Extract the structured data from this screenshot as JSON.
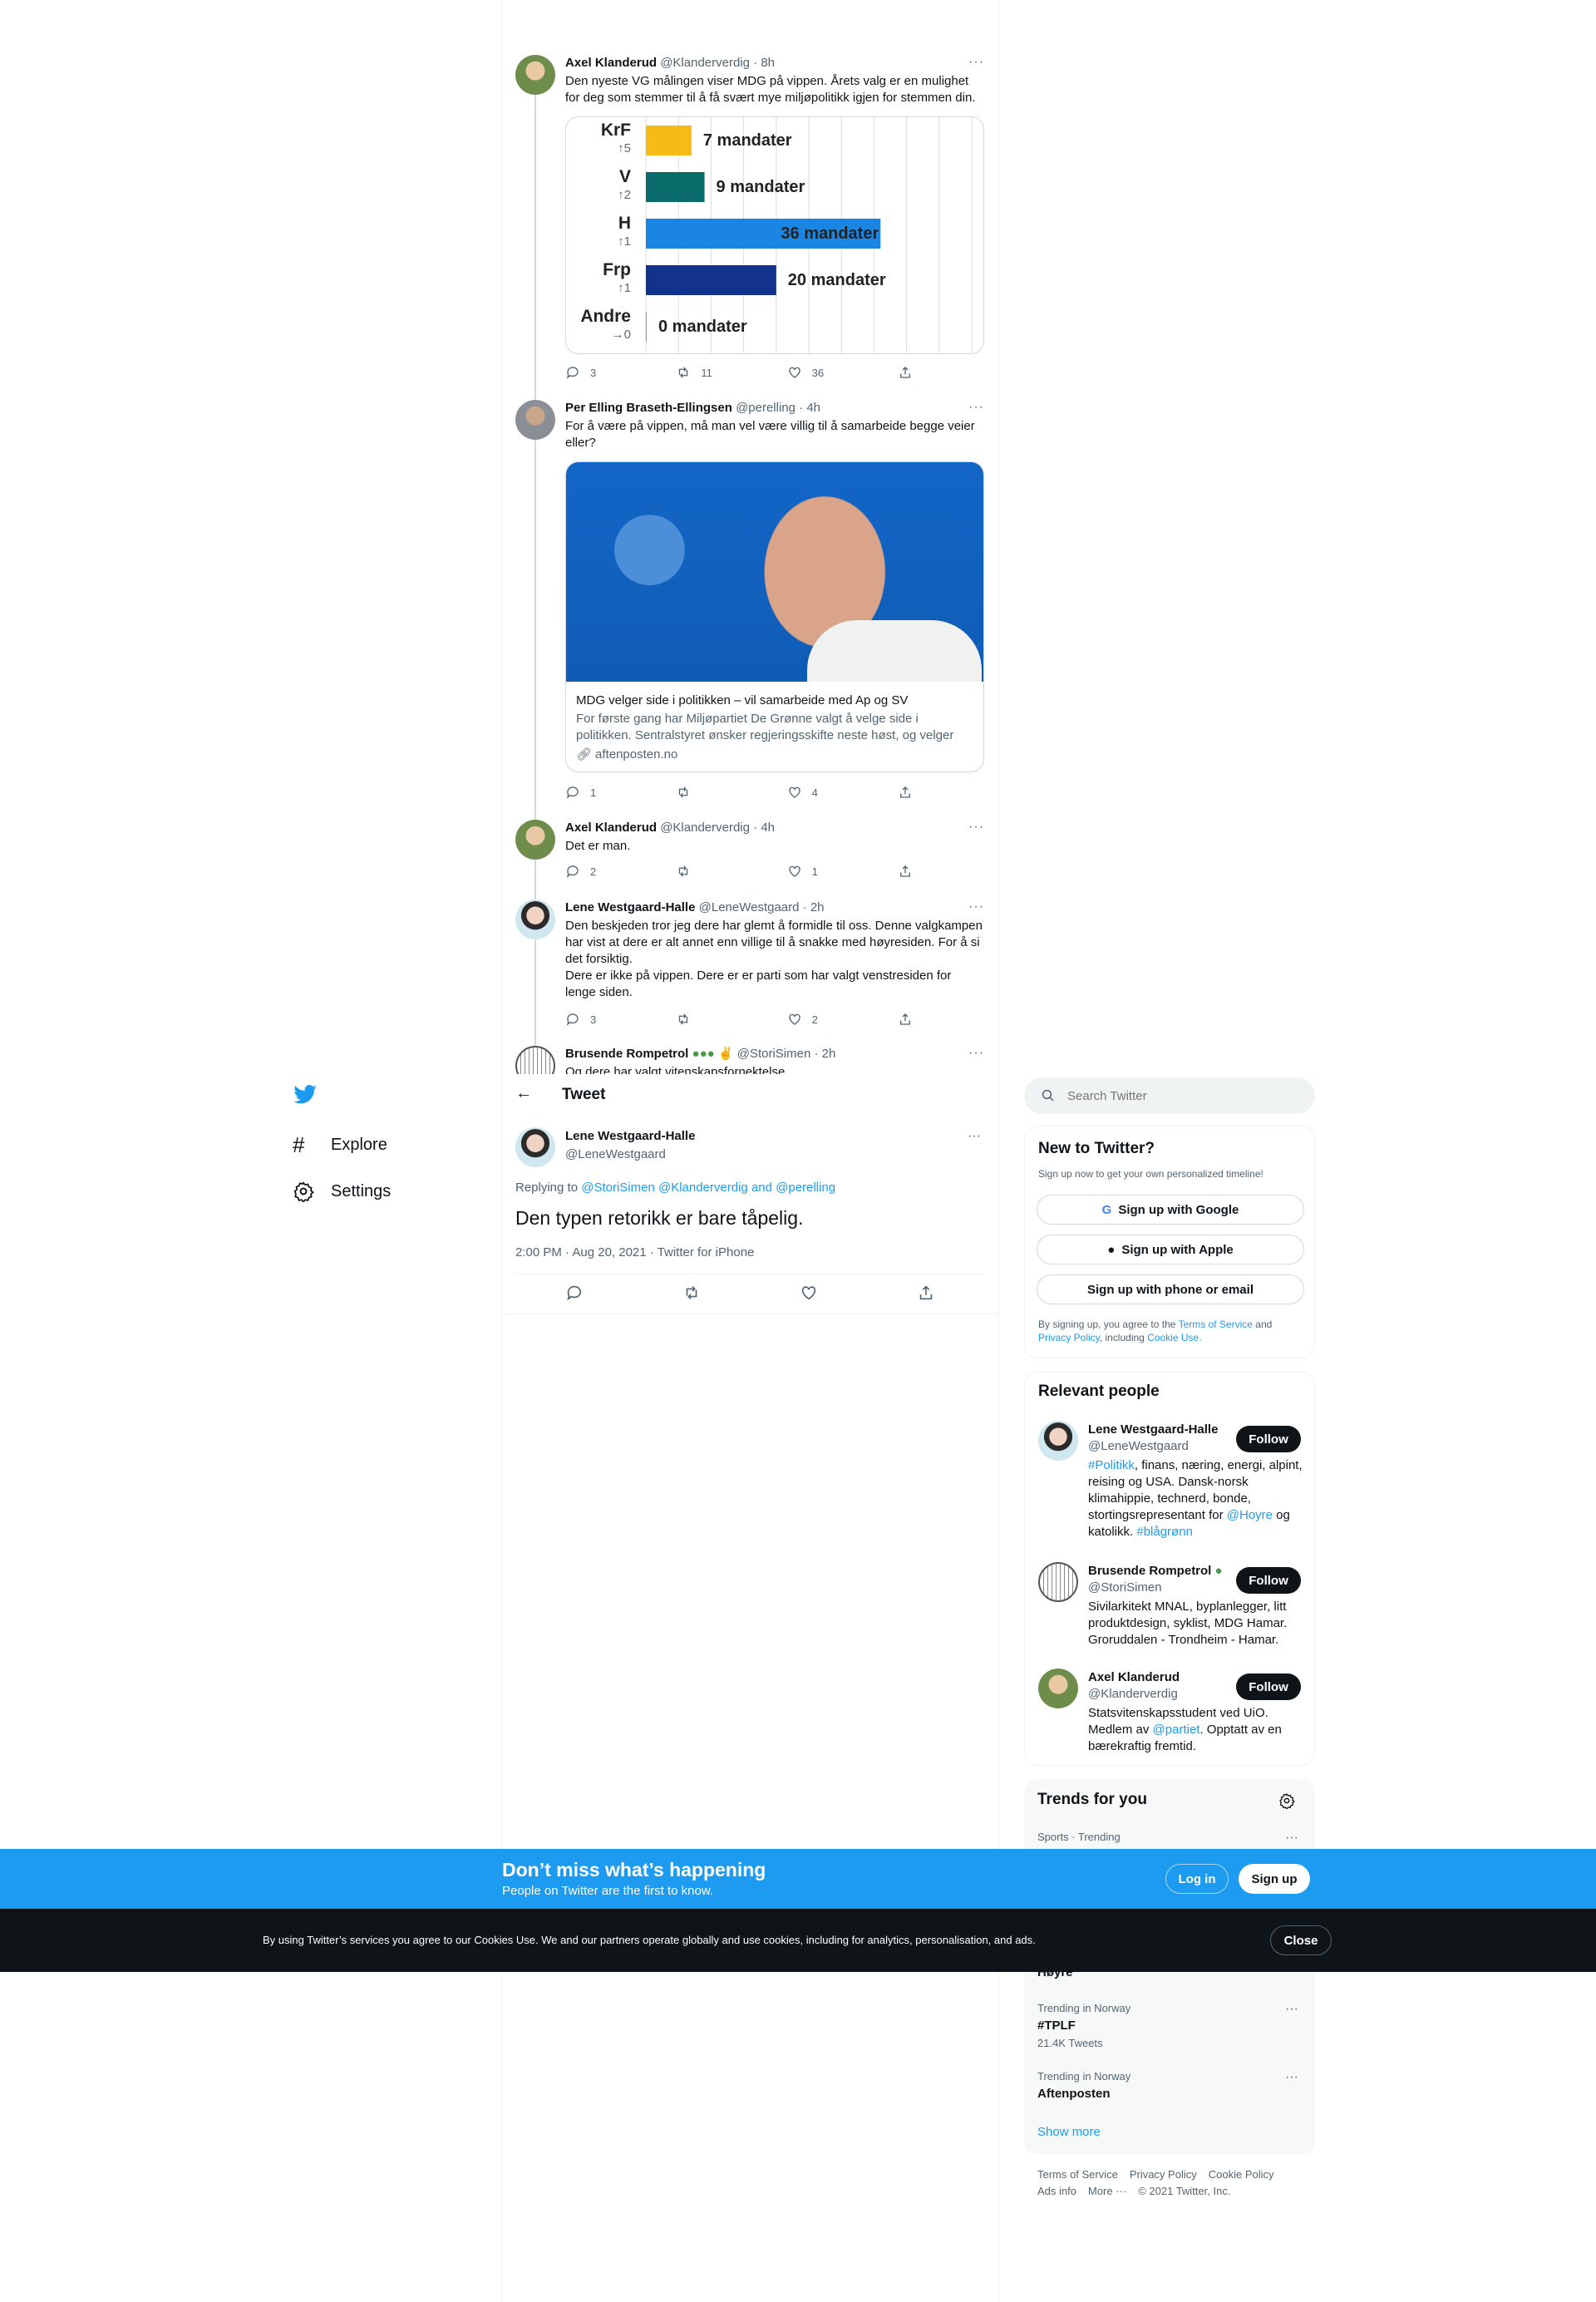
{
  "thread": {
    "t1": {
      "name": "Axel Klanderud",
      "handle": "@Klanderverdig",
      "time": "8h",
      "text": "Den nyeste VG målingen viser MDG på vippen. Årets valg er en mulighet for deg som stemmer til å få svært mye miljøpolitikk igjen for stemmen din.",
      "replies": "3",
      "retweets": "11",
      "likes": "36"
    },
    "chart_data": {
      "type": "bar",
      "categories": [
        "KrF",
        "V",
        "H",
        "Frp",
        "Andre"
      ],
      "changes": [
        "5",
        "2",
        "1",
        "1",
        "0"
      ],
      "values": [
        7,
        9,
        36,
        20,
        0
      ],
      "value_labels": [
        "7 mandater",
        "9 mandater",
        "36 mandater",
        "20 mandater",
        "0 mandater"
      ],
      "colors": [
        "#f7bb16",
        "#0a6b6b",
        "#1b85e3",
        "#12328e",
        "#999999"
      ],
      "xlim": [
        0,
        50
      ]
    },
    "t2": {
      "name": "Per Elling Braseth-Ellingsen",
      "handle": "@perelling",
      "time": "4h",
      "text": "For å være på vippen, må man vel være villig til å samarbeide begge veier eller?",
      "card_title": "MDG velger side i politikken – vil samarbeide med Ap og SV",
      "card_desc": "For første gang har Miljøpartiet De Grønne valgt å velge side i politikken. Sentralstyret ønsker regjeringsskifte neste høst, og velger s...",
      "card_domain": "aftenposten.no",
      "replies": "1",
      "retweets": "",
      "likes": "4"
    },
    "t3": {
      "name": "Axel Klanderud",
      "handle": "@Klanderverdig",
      "time": "4h",
      "text": "Det er man.",
      "replies": "2",
      "retweets": "",
      "likes": "1"
    },
    "t4": {
      "name": "Lene Westgaard-Halle",
      "handle": "@LeneWestgaard",
      "time": "2h",
      "text": "Den beskjeden tror jeg dere har glemt å formidle til oss. Denne valgkampen har vist at dere er alt annet enn villige til å snakke med høyresiden. For å si det forsiktig.\nDere er ikke på vippen. Dere er er parti som har valgt venstresiden for lenge siden.",
      "replies": "3",
      "retweets": "",
      "likes": "2"
    },
    "t5": {
      "name": "Brusende Rompetrol",
      "handle": "@StoriSimen",
      "time": "2h",
      "text": "Og dere har valgt vitenskapsfornektelse"
    }
  },
  "nav": {
    "explore": "Explore",
    "settings": "Settings"
  },
  "main": {
    "header": "Tweet",
    "name": "Lene Westgaard-Halle",
    "handle": "@LeneWestgaard",
    "replying_prefix": "Replying to",
    "replying_to": "@StoriSimen @Klanderverdig",
    "replying_and": "and",
    "replying_last": "@perelling",
    "text": "Den typen retorikk er bare tåpelig.",
    "meta": "2:00 PM · Aug 20, 2021 · Twitter for iPhone"
  },
  "search": {
    "placeholder": "Search Twitter"
  },
  "signup": {
    "title": "New to Twitter?",
    "subtitle": "Sign up now to get your own personalized timeline!",
    "google": "Sign up with Google",
    "apple": "Sign up with Apple",
    "phone": "Sign up with phone or email",
    "terms_a": "By signing up, you agree to the",
    "terms_link": "Terms of Service",
    "terms_and": "and",
    "privacy_link": "Privacy Policy",
    "terms_inc": ", including",
    "cookie_link": "Cookie Use."
  },
  "relevant": {
    "title": "Relevant people",
    "follow": "Follow",
    "p1": {
      "name": "Lene Westgaard-Halle",
      "handle": "@LeneWestgaard",
      "bio_tag": "#Politikk",
      "bio": ", finans, næring, energi, alpint, reising og USA. Dansk-norsk klimahippie, technerd, bonde, stortingsrepresentant for ",
      "bio_link": "@Hoyre",
      "bio_end": " og katolikk. ",
      "bio_tag2": "#blågrønn"
    },
    "p2": {
      "name": "Brusende Rompetrol",
      "handle": "@StoriSimen",
      "bio": "Sivilarkitekt MNAL, byplanlegger, litt produktdesign, syklist, MDG Hamar. Groruddalen - Trondheim - Hamar."
    },
    "p3": {
      "name": "Axel Klanderud",
      "handle": "@Klanderverdig",
      "bio": "Statsvitenskapsstudent ved UiO. Medlem av ",
      "bio_link": "@partiet",
      "bio_end": ". Opptatt av en bærekraftig fremtid."
    }
  },
  "trends": {
    "title": "Trends for you",
    "t1_cat": "Sports · Trending",
    "t2_name": "Høyre",
    "t3_cat": "Trending in Norway",
    "t3_name": "#TPLF",
    "t3_count": "21.4K Tweets",
    "t4_cat": "Trending in Norway",
    "t4_name": "Aftenposten",
    "show_more": "Show more"
  },
  "footer": {
    "terms": "Terms of Service",
    "privacy": "Privacy Policy",
    "cookie": "Cookie Policy",
    "ads": "Ads info",
    "more": "More ···",
    "copy": "© 2021 Twitter, Inc."
  },
  "banner": {
    "title": "Don’t miss what’s happening",
    "subtitle": "People on Twitter are the first to know.",
    "login": "Log in",
    "signup": "Sign up"
  },
  "cookie": {
    "text": "By using Twitter’s services you agree to our Cookies Use. We and our partners operate globally and use cookies, including for analytics, personalisation, and ads.",
    "close": "Close"
  },
  "colors": {
    "accent": "#1d9bf0",
    "dark": "#0f1419",
    "muted": "#536471"
  }
}
